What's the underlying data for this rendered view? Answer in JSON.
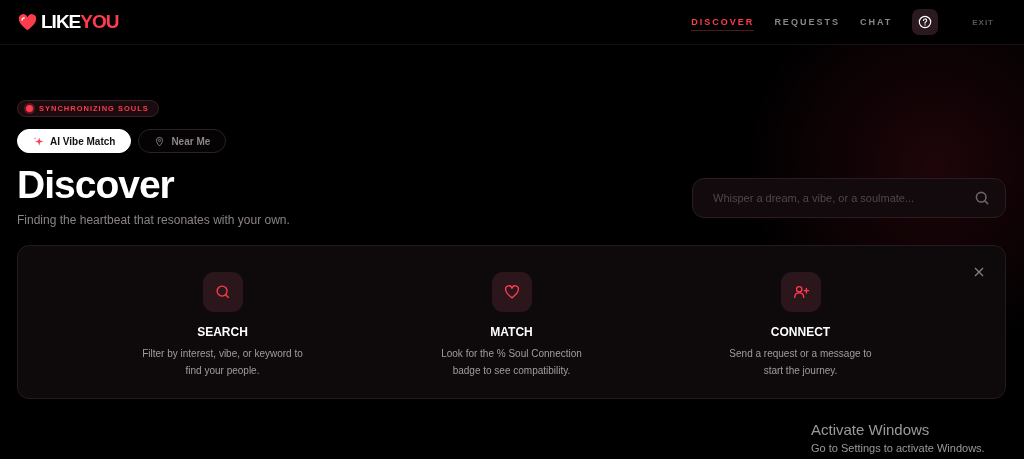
{
  "logo": {
    "primary": "LIKE",
    "accent": "YOU"
  },
  "nav": [
    {
      "label": "DISCOVER",
      "selected": true
    },
    {
      "label": "REQUESTS",
      "selected": false
    },
    {
      "label": "CHAT",
      "selected": false
    }
  ],
  "exit": "EXIT",
  "status_badge": "SYNCHRONIZING SOULS",
  "modes": [
    {
      "label": "AI Vibe Match",
      "kind": "sparkle",
      "selected": true
    },
    {
      "label": "Near Me",
      "kind": "pin",
      "selected": false
    }
  ],
  "title": "Discover",
  "subtitle": "Finding the heartbeat that resonates with your own.",
  "search": {
    "placeholder": "Whisper a dream, a vibe, or a soulmate..."
  },
  "steps": [
    {
      "kind": "search",
      "title": "SEARCH",
      "text": "Filter by interest, vibe, or keyword to find your people."
    },
    {
      "kind": "heart",
      "title": "MATCH",
      "text": "Look for the % Soul Connection badge to see compatibility."
    },
    {
      "kind": "user-plus",
      "title": "CONNECT",
      "text": "Send a request or a message to start the journey."
    }
  ],
  "os_notice": {
    "title": "Activate Windows",
    "text": "Go to Settings to activate Windows."
  }
}
